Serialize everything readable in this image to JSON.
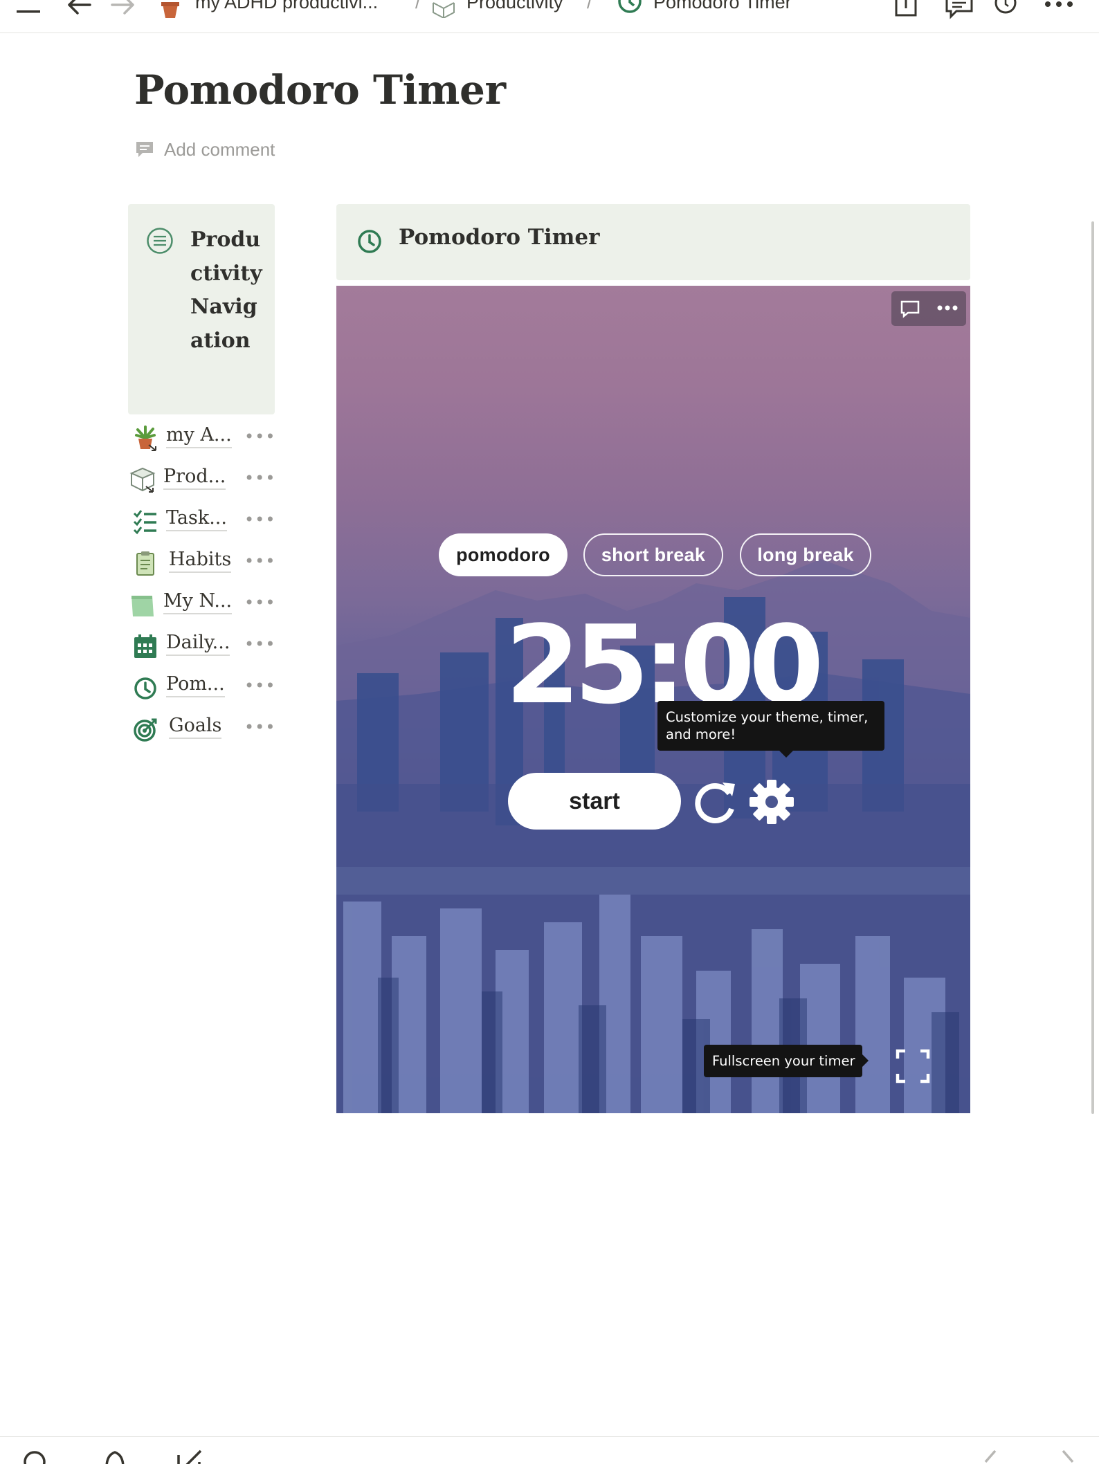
{
  "topbar": {
    "breadcrumbs": [
      {
        "label": "my ADHD productivi..."
      },
      {
        "label": "Productivity"
      },
      {
        "label": "Pomodoro Timer"
      }
    ],
    "separator": "/"
  },
  "page": {
    "title": "Pomodoro Timer",
    "add_comment": "Add comment"
  },
  "nav": {
    "title": "Productivity Navigation",
    "items": [
      {
        "label": "my A...",
        "icon": "potted-plant-icon"
      },
      {
        "label": "Prod...",
        "icon": "box-icon"
      },
      {
        "label": "Task...",
        "icon": "checklist-icon"
      },
      {
        "label": "Habits",
        "icon": "clipboard-icon"
      },
      {
        "label": "My N...",
        "icon": "notebook-icon"
      },
      {
        "label": "Daily...",
        "icon": "calendar-icon"
      },
      {
        "label": "Pom...",
        "icon": "clock-icon"
      },
      {
        "label": "Goals",
        "icon": "target-icon"
      }
    ],
    "more": "•••"
  },
  "timer_callout": {
    "title": "Pomodoro Timer"
  },
  "timer": {
    "modes": [
      "pomodoro",
      "short break",
      "long break"
    ],
    "active_mode": "pomodoro",
    "time": "25:00",
    "start_label": "start",
    "tooltip_customize": "Customize your theme, timer, and more!",
    "tooltip_fullscreen": "Fullscreen your timer"
  },
  "colors": {
    "accent_green": "#2f7b53",
    "callout_bg": "#edf1ea",
    "tooltip_bg": "#141414"
  }
}
